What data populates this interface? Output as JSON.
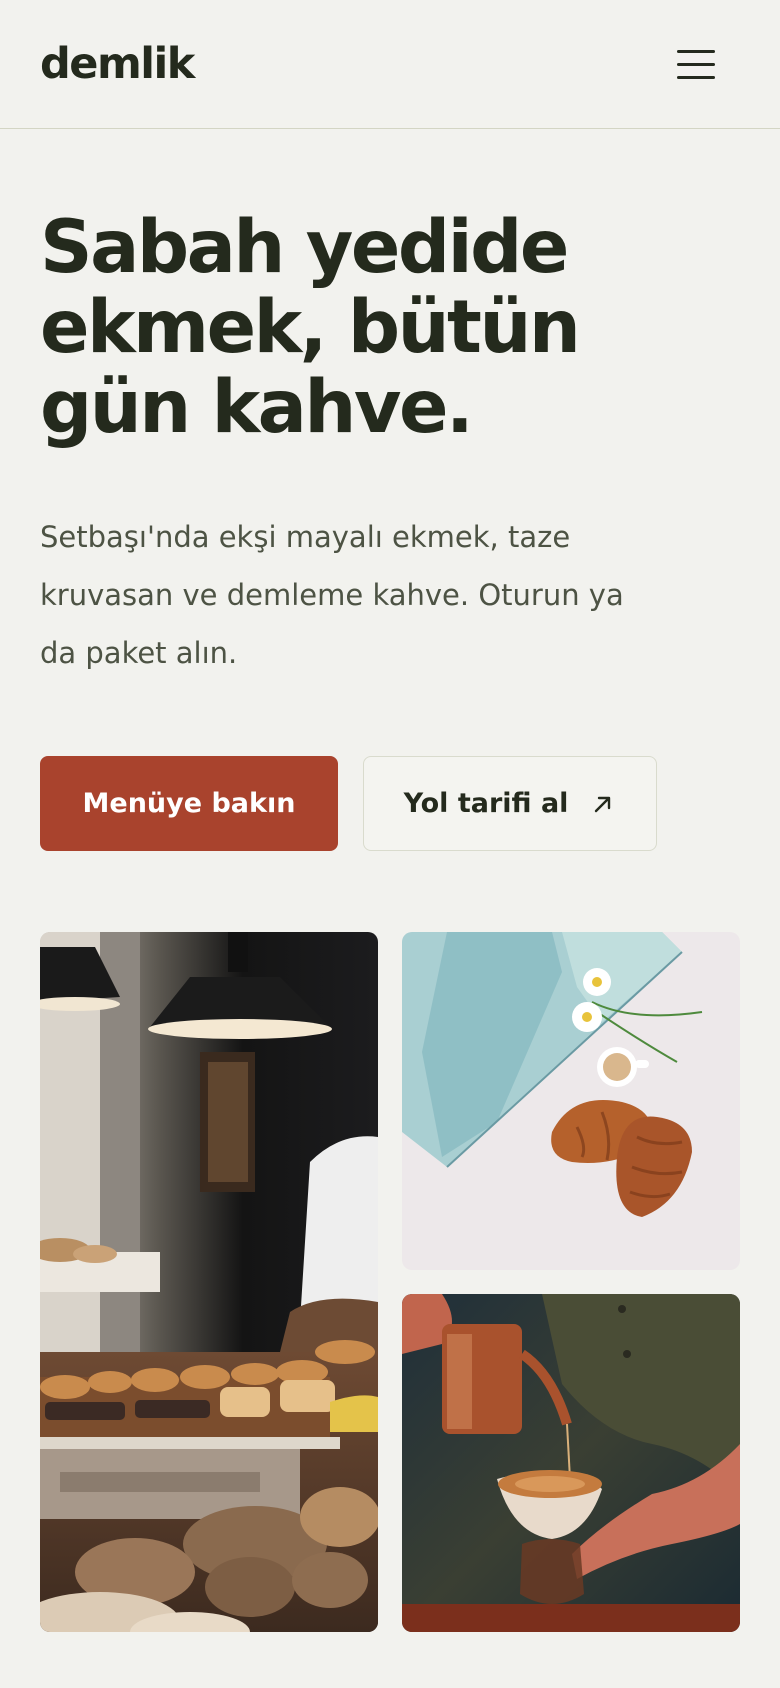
{
  "header": {
    "logo": "demlik",
    "menu_icon": "hamburger-menu-icon"
  },
  "hero": {
    "title_lines": [
      "Sabah yedide",
      "ekmek, bütün",
      "gün kahve."
    ],
    "description_lines": [
      "Setbaşı'nda ekşi mayalı ekmek, taze",
      "kruvasan ve demleme kahve. Oturun ya",
      "da paket alın."
    ]
  },
  "actions": {
    "primary_label": "Menüye bakın",
    "secondary_label": "Yol tarifi al",
    "secondary_icon": "arrow-up-right-icon"
  },
  "colors": {
    "background": "#f2f2ee",
    "text": "#242a1d",
    "accent": "#a9432d"
  }
}
